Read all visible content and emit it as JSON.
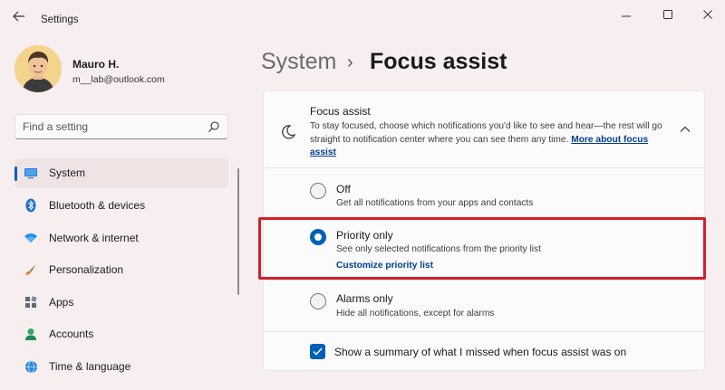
{
  "window": {
    "title": "Settings",
    "back_icon": "back-arrow-icon",
    "controls": [
      "minimize-icon",
      "maximize-icon",
      "close-icon"
    ]
  },
  "profile": {
    "name": "Mauro H.",
    "email": "m__lab@outlook.com"
  },
  "search": {
    "placeholder": "Find a setting",
    "icon": "search-icon"
  },
  "sidebar": {
    "items": [
      {
        "label": "System",
        "icon": "system-icon",
        "active": true
      },
      {
        "label": "Bluetooth & devices",
        "icon": "bluetooth-icon"
      },
      {
        "label": "Network & internet",
        "icon": "wifi-icon"
      },
      {
        "label": "Personalization",
        "icon": "brush-icon"
      },
      {
        "label": "Apps",
        "icon": "apps-icon"
      },
      {
        "label": "Accounts",
        "icon": "person-icon"
      },
      {
        "label": "Time & language",
        "icon": "globe-clock-icon"
      }
    ]
  },
  "breadcrumb": {
    "parent": "System",
    "separator": "›",
    "current": "Focus assist"
  },
  "focus_assist": {
    "title": "Focus assist",
    "description": "To stay focused, choose which notifications you'd like to see and hear—the rest will go straight to notification center where you can see them any time.",
    "link": "More about focus assist",
    "icon": "moon-icon",
    "expanded": true
  },
  "options": [
    {
      "title": "Off",
      "description": "Get all notifications from your apps and contacts",
      "selected": false
    },
    {
      "title": "Priority only",
      "description": "See only selected notifications from the priority list",
      "link": "Customize priority list",
      "selected": true
    },
    {
      "title": "Alarms only",
      "description": "Hide all notifications, except for alarms",
      "selected": false
    }
  ],
  "summary_checkbox": {
    "label": "Show a summary of what I missed when focus assist was on",
    "checked": true
  },
  "colors": {
    "accent": "#005fb8",
    "highlight": "#d21f2b",
    "background": "#f7eeef"
  }
}
